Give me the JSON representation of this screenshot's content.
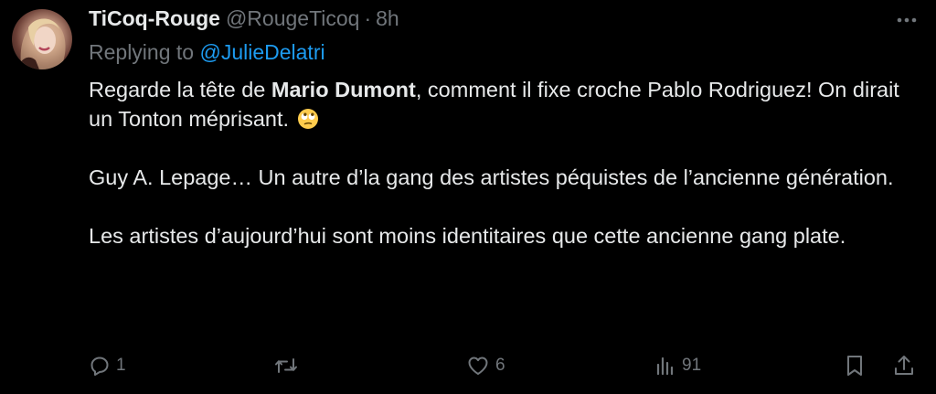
{
  "tweet": {
    "author": {
      "display_name": "TiCoq-Rouge",
      "handle": "@RougeTicoq",
      "separator": "·",
      "time": "8h"
    },
    "reply": {
      "prefix": "Replying to ",
      "mention": "@JulieDelatri"
    },
    "body": {
      "p1_before": "Regarde la tête de ",
      "p1_bold": "Mario Dumont",
      "p1_after": ", comment il fixe croche Pablo Rodriguez! On dirait un Tonton méprisant. ",
      "p2": "Guy A. Lepage… Un autre d’la gang des artistes péquistes de l’ancienne génération.",
      "p3": "Les artistes d’aujourd’hui sont moins identitaires que cette ancienne gang plate."
    },
    "emoji": "face-with-rolling-eyes",
    "actions": {
      "reply_count": "1",
      "retweet_count": "",
      "like_count": "6",
      "views_count": "91"
    }
  },
  "colors": {
    "background": "#000000",
    "text_primary": "#e7e9ea",
    "text_secondary": "#71767b",
    "accent": "#1d9bf0"
  },
  "icons": [
    "more-icon",
    "reply-icon",
    "retweet-icon",
    "like-icon",
    "views-icon",
    "bookmark-icon",
    "share-icon"
  ]
}
